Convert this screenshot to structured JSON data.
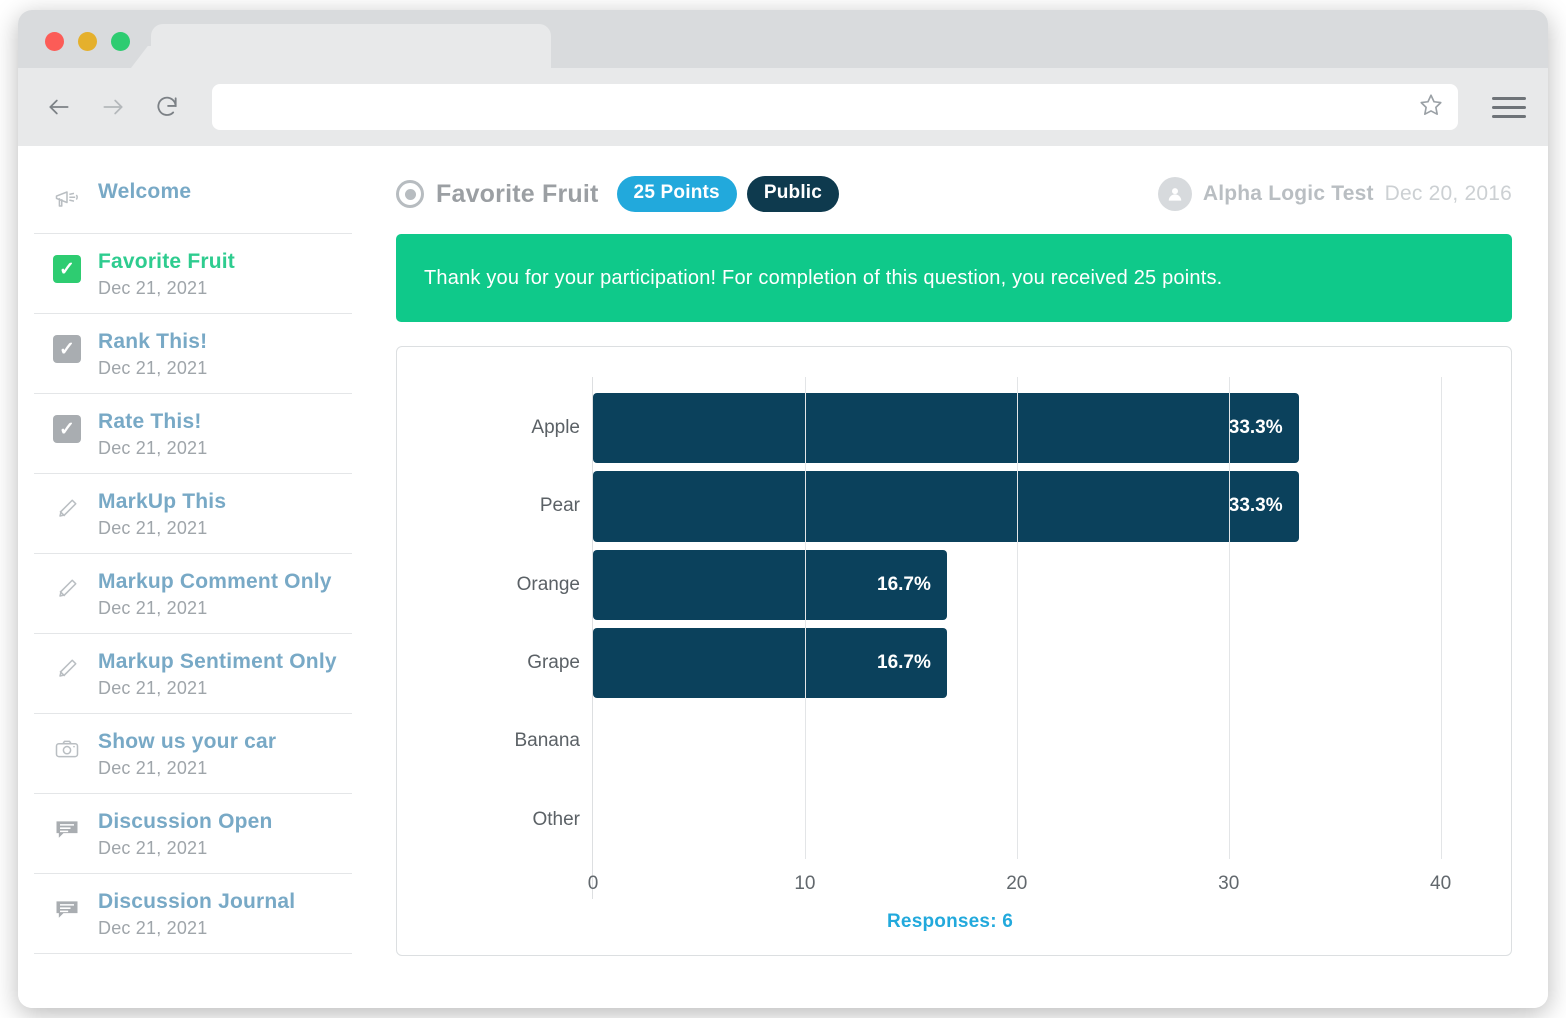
{
  "browser": {
    "back_icon": "arrow-left-icon",
    "forward_icon": "arrow-right-icon",
    "reload_icon": "reload-icon",
    "url_value": "",
    "url_placeholder": "",
    "bookmark_icon": "star-icon",
    "menu_icon": "hamburger-menu-icon"
  },
  "sidebar": {
    "items": [
      {
        "title": "Welcome",
        "date": "",
        "icon": "megaphone-icon",
        "state": "none",
        "active": false
      },
      {
        "title": "Favorite Fruit",
        "date": "Dec 21, 2021",
        "icon": "checkbox-icon",
        "state": "checked-green",
        "active": true
      },
      {
        "title": "Rank This!",
        "date": "Dec 21, 2021",
        "icon": "checkbox-icon",
        "state": "checked-grey",
        "active": false
      },
      {
        "title": "Rate This!",
        "date": "Dec 21, 2021",
        "icon": "checkbox-icon",
        "state": "checked-grey",
        "active": false
      },
      {
        "title": "MarkUp This",
        "date": "Dec 21, 2021",
        "icon": "highlighter-pen-icon",
        "state": "none",
        "active": false
      },
      {
        "title": "Markup Comment Only",
        "date": "Dec 21, 2021",
        "icon": "highlighter-pen-icon",
        "state": "none",
        "active": false
      },
      {
        "title": "Markup Sentiment Only",
        "date": "Dec 21, 2021",
        "icon": "highlighter-pen-icon",
        "state": "none",
        "active": false
      },
      {
        "title": "Show us your car",
        "date": "Dec 21, 2021",
        "icon": "camera-icon",
        "state": "none",
        "active": false
      },
      {
        "title": "Discussion Open",
        "date": "Dec 21, 2021",
        "icon": "comment-bubble-icon",
        "state": "none",
        "active": false
      },
      {
        "title": "Discussion Journal",
        "date": "Dec 21, 2021",
        "icon": "comment-bubble-icon",
        "state": "none",
        "active": false
      }
    ]
  },
  "question": {
    "type_icon": "radio-button-icon",
    "title": "Favorite Fruit",
    "points_badge": "25 Points",
    "visibility_badge": "Public"
  },
  "owner": {
    "avatar_icon": "avatar-icon",
    "name": "Alpha Logic Test",
    "date": "Dec 20, 2016"
  },
  "banner": {
    "message": "Thank you for your participation! For completion of this question, you received 25 points."
  },
  "footer": {
    "responses": "Responses: 6"
  },
  "colors": {
    "bar": "#0b415c",
    "banner_green": "#0fc98a",
    "points_cyan": "#22a9dc",
    "public_navy": "#0e3a4e",
    "sidebar_link": "#78a9c6",
    "sidebar_active": "#2ecc8f"
  },
  "chart_data": {
    "type": "bar",
    "orientation": "horizontal",
    "title": "",
    "xlabel": "",
    "ylabel": "",
    "categories": [
      "Apple",
      "Pear",
      "Orange",
      "Grape",
      "Banana",
      "Other"
    ],
    "values": [
      33.3,
      33.3,
      16.7,
      16.7,
      0,
      0
    ],
    "data_labels": [
      "33.3%",
      "33.3%",
      "16.7%",
      "16.7%",
      "",
      ""
    ],
    "xticks": [
      0,
      10,
      20,
      30,
      40
    ],
    "xlim": [
      0,
      42
    ],
    "grid": true,
    "legend": false,
    "responses": 6
  }
}
